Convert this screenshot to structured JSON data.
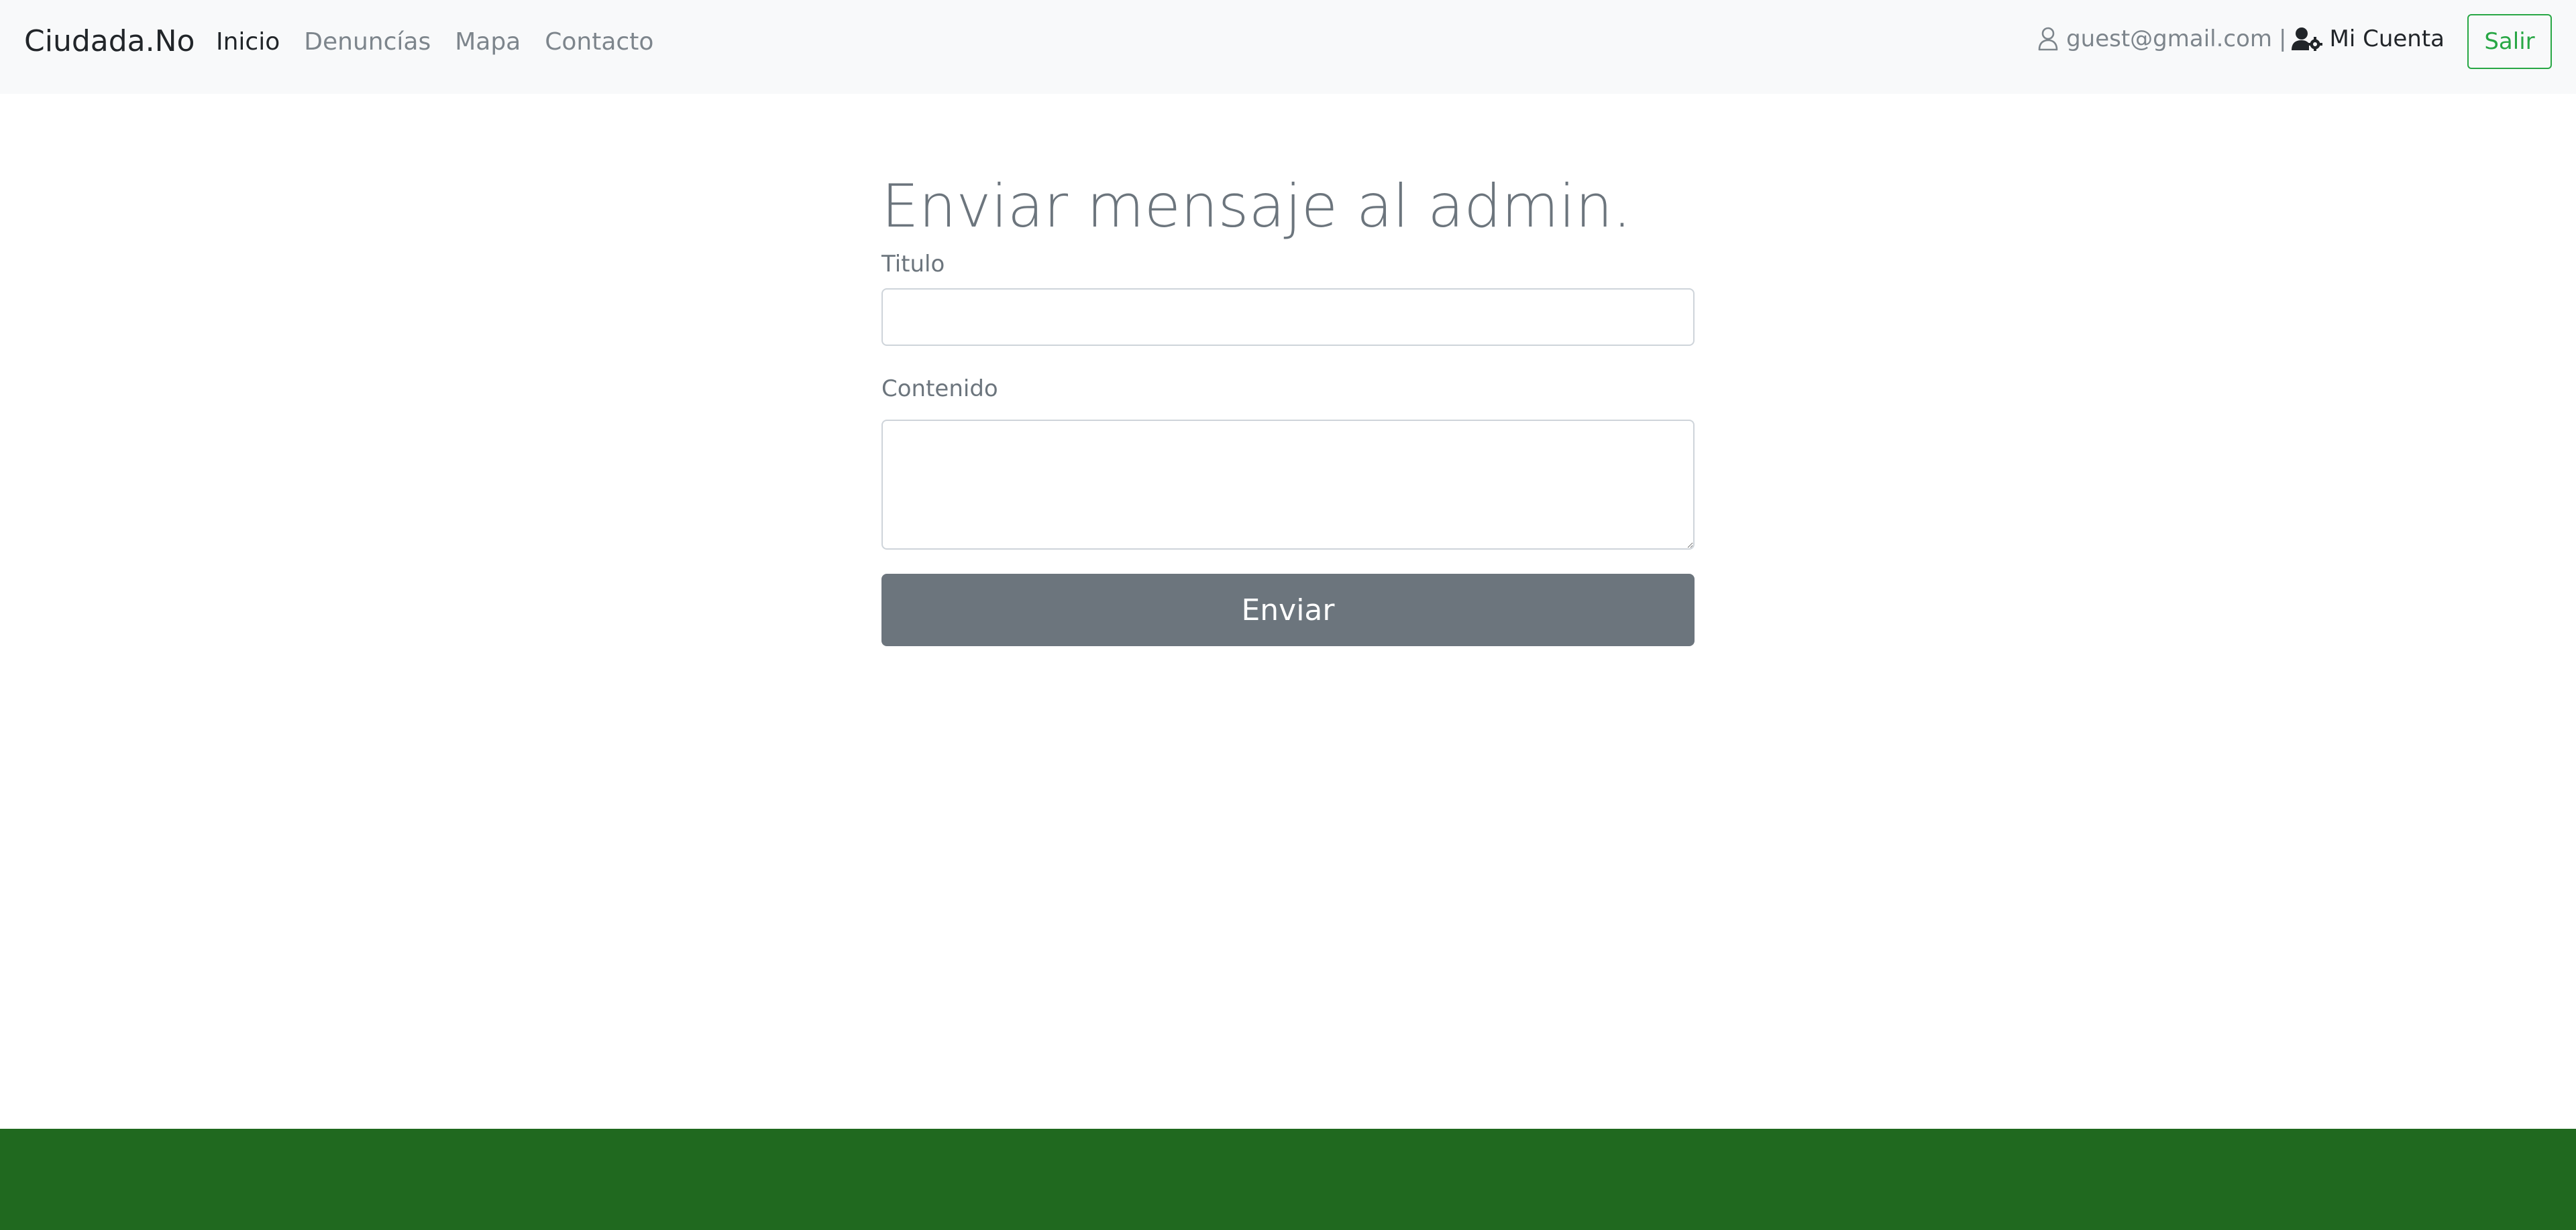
{
  "navbar": {
    "brand": "Ciudada.No",
    "links": [
      {
        "label": "Inicio",
        "active": true
      },
      {
        "label": "Denuncías",
        "active": false
      },
      {
        "label": "Mapa",
        "active": false
      },
      {
        "label": "Contacto",
        "active": false
      }
    ],
    "user_email": "guest@gmail.com",
    "separator": "|",
    "account_label": "Mi Cuenta",
    "logout_label": "Salir",
    "user_icon": "user-outline-icon",
    "account_icon": "user-cog-icon"
  },
  "form": {
    "title": "Enviar mensaje al admin.",
    "title_label": "Titulo",
    "title_value": "",
    "content_label": "Contenido",
    "content_value": "",
    "submit_label": "Enviar"
  },
  "colors": {
    "navbar_bg": "#f8f9fa",
    "accent_green": "#28a745",
    "footer_green": "#20691f",
    "button_gray": "#6c757d"
  }
}
